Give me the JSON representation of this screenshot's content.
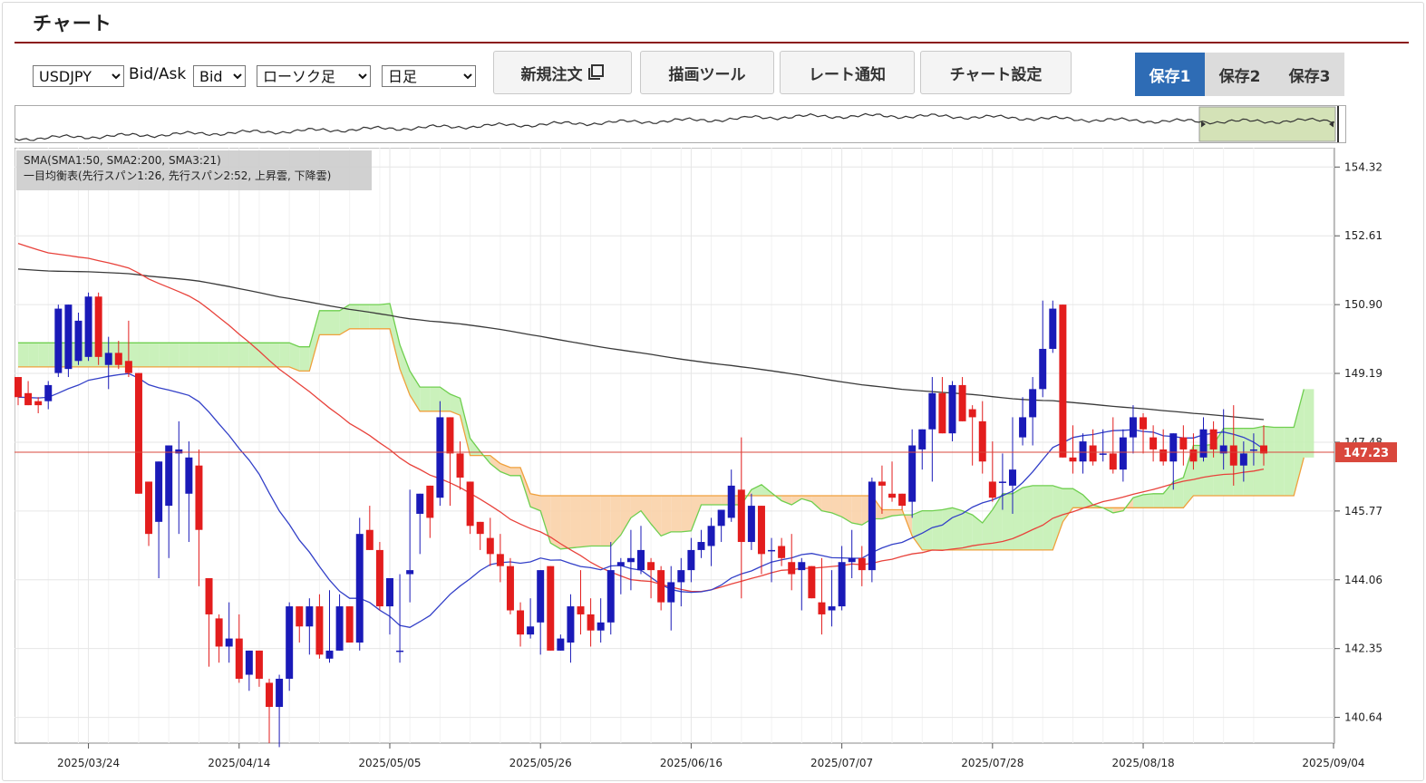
{
  "title": "チャート",
  "controls": {
    "symbol": "USDJPY",
    "bidask_label": "Bid/Ask",
    "side": "Bid",
    "chart_style": "ローソク足",
    "period": "日足"
  },
  "buttons": {
    "new_order": "新規注文",
    "draw_tool": "描画ツール",
    "rate_alert": "レート通知",
    "chart_settings": "チャート設定"
  },
  "save_tabs": [
    "保存1",
    "保存2",
    "保存3"
  ],
  "active_save": 0,
  "legend": {
    "line1": "SMA(SMA1:50, SMA2:200, SMA3:21)",
    "line2": "一目均衡表(先行スパン1:26, 先行スパン2:52, 上昇雲, 下降雲)"
  },
  "colors": {
    "up": "#1a1ab8",
    "down": "#e31d1d",
    "sma50": "#e8423b",
    "sma200": "#3a3a3a",
    "sma21": "#3340c8",
    "cloud_down_fill": "#f9d2a8",
    "cloud_down_line": "#f0a03c",
    "cloud_up_fill": "#c4efb4",
    "cloud_up_line": "#6fcf4f",
    "price_tag": "#d9473c",
    "nav_window": "#d4e2b7"
  },
  "chart_data": {
    "type": "candlestick",
    "current_price": "147.23",
    "y_ticks": [
      "154.32",
      "152.61",
      "150.90",
      "149.19",
      "147.48",
      "145.77",
      "144.06",
      "142.35",
      "140.64"
    ],
    "x_ticks": [
      "2025/03/24",
      "2025/04/14",
      "2025/05/05",
      "2025/05/26",
      "2025/06/16",
      "2025/07/07",
      "2025/07/28",
      "2025/08/18",
      "2025/09/04"
    ],
    "ylim": [
      140.0,
      154.8
    ],
    "candles": [
      [
        149.1,
        148.9,
        148.4,
        148.6
      ],
      [
        148.7,
        149.0,
        148.5,
        148.4
      ],
      [
        148.5,
        148.6,
        148.2,
        148.4
      ],
      [
        148.5,
        149.0,
        148.3,
        148.9
      ],
      [
        149.2,
        150.9,
        149.1,
        150.8
      ],
      [
        149.3,
        150.9,
        149.1,
        150.9
      ],
      [
        149.5,
        150.7,
        149.4,
        150.5
      ],
      [
        149.6,
        151.2,
        149.5,
        151.1
      ],
      [
        151.1,
        151.2,
        149.4,
        149.6
      ],
      [
        149.4,
        150.1,
        148.8,
        149.7
      ],
      [
        149.7,
        150.0,
        149.3,
        149.4
      ],
      [
        149.5,
        150.5,
        149.1,
        149.2
      ],
      [
        149.2,
        148.9,
        147.0,
        146.2
      ],
      [
        146.5,
        146.5,
        144.9,
        145.2
      ],
      [
        145.5,
        146.4,
        144.1,
        147.0
      ],
      [
        145.9,
        147.4,
        144.6,
        147.4
      ],
      [
        147.2,
        148.0,
        145.2,
        147.3
      ],
      [
        146.2,
        147.5,
        145.0,
        147.1
      ],
      [
        146.9,
        147.3,
        143.9,
        145.3
      ],
      [
        144.1,
        144.1,
        141.9,
        143.2
      ],
      [
        143.1,
        143.2,
        142.0,
        142.4
      ],
      [
        142.4,
        143.5,
        142.0,
        142.6
      ],
      [
        142.6,
        143.2,
        141.5,
        141.6
      ],
      [
        141.7,
        142.3,
        141.3,
        142.3
      ],
      [
        142.3,
        142.1,
        141.4,
        141.6
      ],
      [
        141.5,
        141.6,
        140.0,
        140.9
      ],
      [
        140.9,
        141.7,
        139.9,
        141.6
      ],
      [
        141.6,
        143.5,
        141.3,
        143.4
      ],
      [
        143.4,
        143.2,
        142.5,
        142.9
      ],
      [
        142.9,
        143.6,
        142.2,
        143.4
      ],
      [
        143.4,
        143.7,
        142.1,
        142.2
      ],
      [
        142.1,
        143.8,
        142.0,
        142.3
      ],
      [
        142.3,
        143.7,
        142.3,
        143.4
      ],
      [
        143.4,
        143.3,
        142.8,
        142.5
      ],
      [
        142.5,
        145.6,
        142.3,
        145.2
      ],
      [
        145.3,
        145.9,
        144.8,
        144.8
      ],
      [
        144.8,
        145.0,
        143.3,
        143.4
      ],
      [
        143.4,
        144.1,
        142.7,
        144.1
      ],
      [
        142.3,
        144.2,
        142.0,
        142.3
      ],
      [
        144.2,
        146.3,
        143.5,
        144.3
      ],
      [
        145.7,
        146.2,
        144.7,
        146.2
      ],
      [
        146.4,
        146.4,
        145.1,
        145.6
      ],
      [
        146.1,
        148.5,
        145.9,
        148.1
      ],
      [
        148.1,
        148.1,
        145.9,
        147.2
      ],
      [
        147.2,
        147.5,
        146.3,
        146.6
      ],
      [
        146.5,
        146.3,
        145.2,
        145.4
      ],
      [
        145.5,
        145.5,
        144.8,
        145.2
      ],
      [
        145.1,
        145.6,
        144.4,
        144.7
      ],
      [
        144.7,
        145.2,
        144.0,
        144.4
      ],
      [
        144.4,
        144.6,
        143.2,
        143.3
      ],
      [
        143.3,
        143.5,
        142.4,
        142.7
      ],
      [
        142.7,
        143.6,
        142.6,
        142.9
      ],
      [
        143.0,
        144.3,
        142.2,
        144.3
      ],
      [
        144.4,
        144.3,
        143.7,
        142.3
      ],
      [
        142.3,
        142.7,
        142.4,
        142.6
      ],
      [
        142.5,
        143.7,
        142.0,
        143.4
      ],
      [
        143.4,
        144.3,
        142.7,
        143.2
      ],
      [
        143.2,
        143.6,
        142.4,
        142.8
      ],
      [
        142.8,
        143.6,
        142.5,
        143.0
      ],
      [
        143.0,
        145.0,
        142.7,
        144.3
      ],
      [
        144.4,
        144.6,
        143.7,
        144.5
      ],
      [
        144.5,
        145.3,
        143.8,
        144.6
      ],
      [
        144.3,
        145.4,
        144.2,
        144.8
      ],
      [
        144.5,
        144.6,
        143.6,
        144.3
      ],
      [
        144.3,
        144.4,
        143.3,
        143.5
      ],
      [
        143.5,
        144.4,
        142.8,
        144.0
      ],
      [
        144.0,
        144.6,
        143.4,
        144.3
      ],
      [
        144.3,
        145.1,
        144.0,
        144.8
      ],
      [
        144.8,
        145.3,
        144.6,
        145.0
      ],
      [
        144.9,
        145.6,
        144.4,
        145.4
      ],
      [
        145.4,
        145.7,
        145.0,
        145.8
      ],
      [
        145.6,
        146.8,
        145.5,
        146.4
      ],
      [
        146.3,
        147.6,
        143.6,
        145.0
      ],
      [
        145.0,
        146.2,
        144.8,
        145.9
      ],
      [
        145.9,
        145.9,
        144.2,
        144.7
      ],
      [
        144.8,
        145.1,
        144.0,
        144.8
      ],
      [
        144.9,
        145.1,
        144.4,
        144.6
      ],
      [
        144.5,
        145.2,
        143.8,
        144.2
      ],
      [
        144.3,
        144.6,
        143.3,
        144.5
      ],
      [
        144.4,
        144.3,
        143.8,
        143.6
      ],
      [
        143.5,
        144.6,
        142.7,
        143.2
      ],
      [
        143.3,
        144.3,
        142.9,
        143.4
      ],
      [
        143.4,
        144.9,
        143.3,
        144.5
      ],
      [
        144.5,
        145.3,
        144.1,
        144.6
      ],
      [
        144.6,
        144.9,
        143.9,
        144.3
      ],
      [
        144.3,
        146.6,
        144.0,
        146.5
      ],
      [
        146.5,
        146.9,
        145.7,
        146.4
      ],
      [
        146.2,
        147.0,
        146.0,
        146.1
      ],
      [
        146.2,
        146.2,
        145.8,
        145.9
      ],
      [
        146.0,
        147.8,
        145.6,
        147.4
      ],
      [
        147.3,
        147.8,
        146.8,
        147.8
      ],
      [
        147.8,
        149.1,
        146.5,
        148.7
      ],
      [
        148.7,
        149.1,
        147.9,
        147.7
      ],
      [
        147.7,
        149.0,
        147.5,
        148.9
      ],
      [
        148.9,
        149.1,
        148.0,
        148.0
      ],
      [
        148.3,
        148.4,
        146.9,
        148.1
      ],
      [
        148.0,
        148.5,
        146.7,
        147.0
      ],
      [
        146.5,
        147.5,
        146.0,
        146.1
      ],
      [
        146.5,
        147.2,
        145.8,
        146.5
      ],
      [
        146.4,
        148.1,
        145.7,
        146.8
      ],
      [
        147.6,
        148.6,
        147.4,
        148.1
      ],
      [
        148.1,
        149.1,
        147.4,
        148.8
      ],
      [
        148.8,
        151.0,
        148.6,
        149.8
      ],
      [
        149.8,
        151.0,
        149.7,
        150.8
      ],
      [
        150.9,
        150.9,
        147.1,
        147.1
      ],
      [
        147.1,
        147.9,
        146.7,
        147.0
      ],
      [
        147.0,
        147.7,
        146.7,
        147.5
      ],
      [
        147.4,
        147.8,
        146.9,
        147.0
      ],
      [
        147.2,
        147.8,
        147.0,
        147.2
      ],
      [
        147.2,
        148.1,
        146.7,
        146.8
      ],
      [
        146.8,
        147.8,
        146.5,
        147.6
      ],
      [
        147.6,
        148.4,
        147.2,
        148.1
      ],
      [
        148.1,
        148.2,
        147.2,
        147.8
      ],
      [
        147.6,
        147.9,
        147.0,
        147.3
      ],
      [
        147.3,
        147.8,
        146.9,
        147.0
      ],
      [
        147.0,
        147.7,
        146.3,
        147.7
      ],
      [
        147.6,
        147.9,
        146.9,
        147.3
      ],
      [
        147.3,
        147.7,
        146.8,
        147.0
      ],
      [
        147.1,
        148.1,
        147.0,
        147.8
      ],
      [
        147.8,
        148.0,
        147.1,
        147.3
      ],
      [
        147.2,
        148.3,
        146.8,
        147.4
      ],
      [
        147.4,
        148.4,
        146.4,
        146.9
      ],
      [
        146.9,
        147.5,
        146.5,
        147.2
      ],
      [
        147.3,
        147.7,
        146.9,
        147.3
      ],
      [
        147.4,
        147.9,
        146.9,
        147.2
      ]
    ],
    "sma50_start": 152.5,
    "sma200_start": 151.8
  }
}
